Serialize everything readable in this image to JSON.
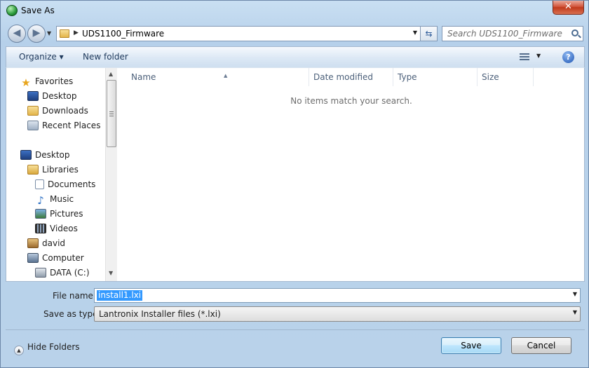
{
  "window": {
    "title": "Save As",
    "close_label": "✕"
  },
  "address": {
    "path": "UDS1100_Firmware"
  },
  "search": {
    "placeholder": "Search UDS1100_Firmware"
  },
  "toolbar": {
    "organize_label": "Organize ▾",
    "new_folder_label": "New folder",
    "help_label": "?"
  },
  "nav": {
    "favorites": [
      {
        "label": "Favorites",
        "icon": "star-icon"
      },
      {
        "label": "Desktop",
        "icon": "desktop-icon"
      },
      {
        "label": "Downloads",
        "icon": "downloads-icon"
      },
      {
        "label": "Recent Places",
        "icon": "recent-places-icon"
      }
    ],
    "tree": [
      {
        "label": "Desktop",
        "icon": "desktop-icon"
      },
      {
        "label": "Libraries",
        "icon": "libraries-icon"
      },
      {
        "label": "Documents",
        "icon": "document-icon"
      },
      {
        "label": "Music",
        "icon": "music-icon"
      },
      {
        "label": "Pictures",
        "icon": "pictures-icon"
      },
      {
        "label": "Videos",
        "icon": "videos-icon"
      },
      {
        "label": "david",
        "icon": "user-folder-icon"
      },
      {
        "label": "Computer",
        "icon": "computer-icon"
      },
      {
        "label": "DATA (C:)",
        "icon": "drive-icon"
      }
    ]
  },
  "list": {
    "columns": [
      "Name",
      "Date modified",
      "Type",
      "Size"
    ],
    "empty_message": "No items match your search."
  },
  "fields": {
    "file_name_label": "File name:",
    "file_name_value": "install1.lxi",
    "save_type_label": "Save as type:",
    "save_type_value": "Lantronix Installer files (*.lxi)"
  },
  "footer": {
    "hide_folders_label": "Hide Folders",
    "save_label": "Save",
    "cancel_label": "Cancel"
  }
}
